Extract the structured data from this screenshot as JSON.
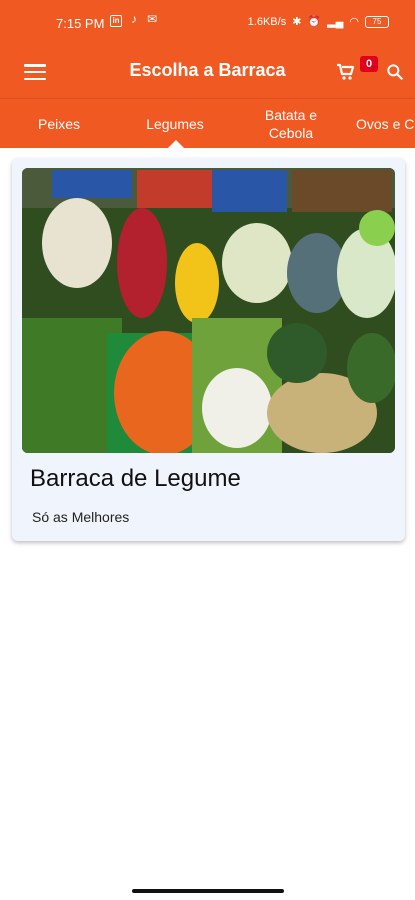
{
  "status_bar": {
    "time": "7:15 PM",
    "network_speed": "1.6KB/s",
    "battery": "75"
  },
  "app_bar": {
    "title": "Escolha a Barraca",
    "cart_count": "0",
    "color": "#f05a22"
  },
  "tabs": [
    {
      "label": "Peixes"
    },
    {
      "label": "Legumes",
      "selected": true
    },
    {
      "label": "Batata e Cebola"
    },
    {
      "label": "Ovos e C"
    }
  ],
  "card": {
    "title": "Barraca de Legume",
    "subtitle": "Só as Melhores"
  },
  "icons": {
    "menu": "menu-icon",
    "cart": "cart-icon",
    "search": "search-icon"
  }
}
